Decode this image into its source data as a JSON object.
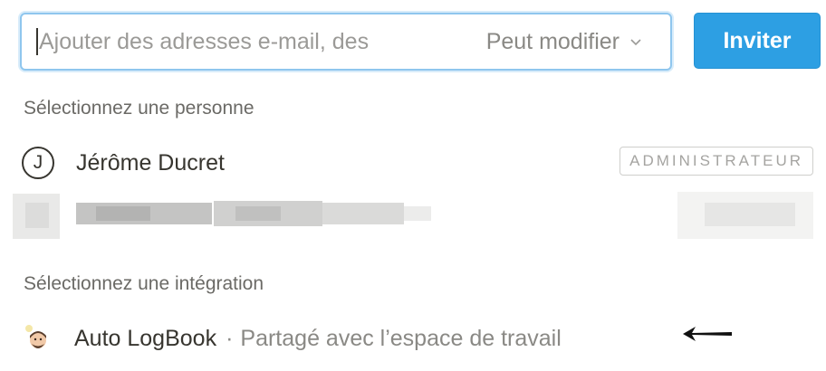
{
  "invite": {
    "placeholder": "Ajouter des adresses e-mail, des",
    "permission_label": "Peut modifier",
    "button_label": "Inviter"
  },
  "people_section": {
    "title": "Sélectionnez une personne",
    "people": [
      {
        "initial": "J",
        "name": "Jérôme Ducret",
        "role": "ADMINISTRATEUR"
      }
    ]
  },
  "integration_section": {
    "title": "Sélectionnez une intégration",
    "integrations": [
      {
        "name": "Auto LogBook",
        "separator": "·",
        "description": "Partagé avec l’espace de travail"
      }
    ]
  },
  "colors": {
    "accent": "#2d9fe3",
    "focus_border": "#8fc6ee"
  }
}
